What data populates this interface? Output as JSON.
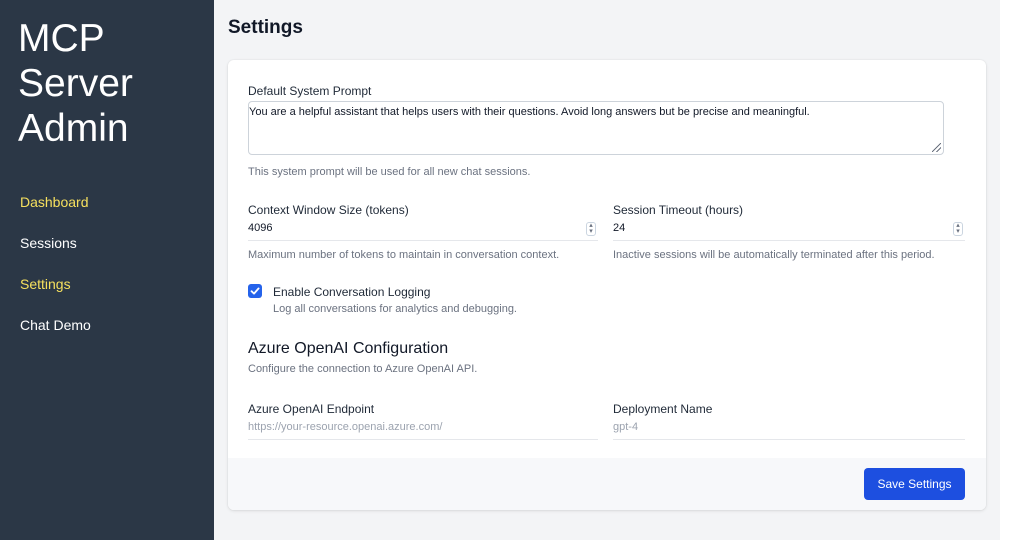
{
  "sidebar": {
    "brand": "MCP Server Admin",
    "items": [
      {
        "label": "Dashboard",
        "active": true
      },
      {
        "label": "Sessions",
        "active": false
      },
      {
        "label": "Settings",
        "active": true
      },
      {
        "label": "Chat Demo",
        "active": false
      }
    ],
    "colors": {
      "background": "#2b3746",
      "accent": "#f6e05e"
    }
  },
  "page": {
    "title": "Settings"
  },
  "settings": {
    "system_prompt": {
      "label": "Default System Prompt",
      "value": "You are a helpful assistant that helps users with their questions. Avoid long answers but be precise and meaningful.",
      "help": "This system prompt will be used for all new chat sessions."
    },
    "context_window": {
      "label": "Context Window Size (tokens)",
      "value": "4096",
      "help": "Maximum number of tokens to maintain in conversation context."
    },
    "session_timeout": {
      "label": "Session Timeout (hours)",
      "value": "24",
      "help": "Inactive sessions will be automatically terminated after this period."
    },
    "logging": {
      "label": "Enable Conversation Logging",
      "help": "Log all conversations for analytics and debugging.",
      "checked": true
    },
    "azure": {
      "title": "Azure OpenAI Configuration",
      "subtitle": "Configure the connection to Azure OpenAI API.",
      "endpoint": {
        "label": "Azure OpenAI Endpoint",
        "placeholder": "https://your-resource.openai.azure.com/"
      },
      "deployment": {
        "label": "Deployment Name",
        "placeholder": "gpt-4"
      }
    },
    "save_label": "Save Settings",
    "colors": {
      "primary": "#1d4fe0"
    }
  }
}
